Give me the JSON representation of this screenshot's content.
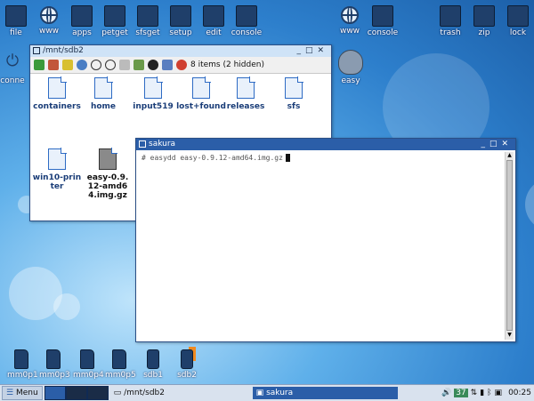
{
  "top_icons_left": [
    {
      "label": "file",
      "icon": "home-icon"
    },
    {
      "label": "www",
      "icon": "globe-icon"
    },
    {
      "label": "apps",
      "icon": "apps-icon"
    },
    {
      "label": "petget",
      "icon": "package-icon"
    },
    {
      "label": "sfsget",
      "icon": "sfs-package-icon"
    },
    {
      "label": "setup",
      "icon": "wrench-icon"
    },
    {
      "label": "edit",
      "icon": "edit-icon"
    },
    {
      "label": "console",
      "icon": "terminal-icon"
    }
  ],
  "top_icons_mid": [
    {
      "label": "www",
      "icon": "globe-icon"
    },
    {
      "label": "console",
      "icon": "terminal-icon"
    }
  ],
  "top_icons_right": [
    {
      "label": "trash",
      "icon": "trash-icon"
    },
    {
      "label": "zip",
      "icon": "zip-icon"
    },
    {
      "label": "lock",
      "icon": "lock-icon"
    }
  ],
  "side_icons": {
    "connect": "conne",
    "easy": "easy"
  },
  "file_window": {
    "title": "/mnt/sdb2",
    "status": "8 items (2 hidden)",
    "files": [
      "containers",
      "home",
      "input519",
      "lost+found",
      "releases",
      "sfs",
      "win10-printer",
      "easy-0.9.12-amd64.img.gz"
    ]
  },
  "terminal": {
    "title": "sakura",
    "command": "# easydd easy-0.9.12-amd64.img.gz"
  },
  "drives": [
    "mm0p1",
    "mm0p3",
    "mm0p4",
    "mm0p5",
    "sdb1",
    "sdb2"
  ],
  "taskbar": {
    "menu": "Menu",
    "task1": "/mnt/sdb2",
    "task2": "sakura",
    "temp": "37",
    "clock": "00:25"
  },
  "colors": {
    "titlebar_active": "#2b5ea8",
    "folder_text": "#1a3d78",
    "desktop": "#2d7fcc"
  }
}
